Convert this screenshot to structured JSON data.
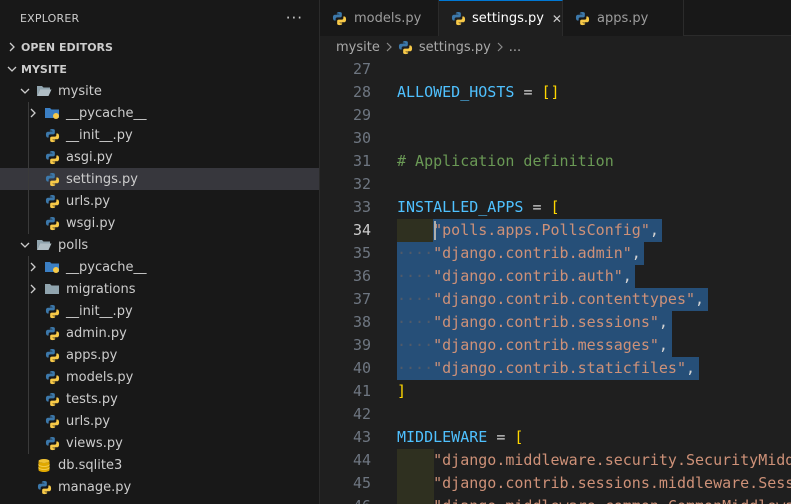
{
  "explorer": {
    "title": "EXPLORER",
    "more": "···",
    "open_editors": "OPEN EDITORS",
    "project": "MYSITE",
    "tree": [
      {
        "label": "mysite",
        "type": "folder-open",
        "depth": 1
      },
      {
        "label": "__pycache__",
        "type": "folder-pycache",
        "depth": 2
      },
      {
        "label": "__init__.py",
        "type": "python",
        "depth": 2
      },
      {
        "label": "asgi.py",
        "type": "python",
        "depth": 2
      },
      {
        "label": "settings.py",
        "type": "python",
        "depth": 2,
        "selected": true
      },
      {
        "label": "urls.py",
        "type": "python",
        "depth": 2
      },
      {
        "label": "wsgi.py",
        "type": "python",
        "depth": 2
      },
      {
        "label": "polls",
        "type": "folder-open",
        "depth": 1
      },
      {
        "label": "__pycache__",
        "type": "folder-pycache",
        "depth": 2
      },
      {
        "label": "migrations",
        "type": "folder",
        "depth": 2
      },
      {
        "label": "__init__.py",
        "type": "python",
        "depth": 2
      },
      {
        "label": "admin.py",
        "type": "python",
        "depth": 2
      },
      {
        "label": "apps.py",
        "type": "python",
        "depth": 2
      },
      {
        "label": "models.py",
        "type": "python",
        "depth": 2
      },
      {
        "label": "tests.py",
        "type": "python",
        "depth": 2
      },
      {
        "label": "urls.py",
        "type": "python",
        "depth": 2
      },
      {
        "label": "views.py",
        "type": "python",
        "depth": 2
      },
      {
        "label": "db.sqlite3",
        "type": "database",
        "depth": 1
      },
      {
        "label": "manage.py",
        "type": "python",
        "depth": 1
      }
    ]
  },
  "tabs": [
    {
      "label": "models.py",
      "active": false
    },
    {
      "label": "settings.py",
      "active": true
    },
    {
      "label": "apps.py",
      "active": false
    }
  ],
  "tab_close": "✕",
  "breadcrumb": {
    "folder": "mysite",
    "file": "settings.py",
    "more": "..."
  },
  "editor": {
    "current_line": 34,
    "lines": [
      {
        "n": "27",
        "text": ""
      },
      {
        "n": "28",
        "text": "ALLOWED_HOSTS = []"
      },
      {
        "n": "29",
        "text": ""
      },
      {
        "n": "30",
        "text": ""
      },
      {
        "n": "31",
        "text": "# Application definition"
      },
      {
        "n": "32",
        "text": ""
      },
      {
        "n": "33",
        "text": "INSTALLED_APPS = ["
      },
      {
        "n": "34",
        "text": "\"polls.apps.PollsConfig\","
      },
      {
        "n": "35",
        "text": "\"django.contrib.admin\","
      },
      {
        "n": "36",
        "text": "\"django.contrib.auth\","
      },
      {
        "n": "37",
        "text": "\"django.contrib.contenttypes\","
      },
      {
        "n": "38",
        "text": "\"django.contrib.sessions\","
      },
      {
        "n": "39",
        "text": "\"django.contrib.messages\","
      },
      {
        "n": "40",
        "text": "\"django.contrib.staticfiles\","
      },
      {
        "n": "41",
        "text": "]"
      },
      {
        "n": "42",
        "text": ""
      },
      {
        "n": "43",
        "text": "MIDDLEWARE = ["
      },
      {
        "n": "44",
        "text": "\"django.middleware.security.SecurityMiddleware\","
      },
      {
        "n": "45",
        "text": "\"django.contrib.sessions.middleware.SessionMiddleware\","
      },
      {
        "n": "46",
        "text": "\"django.middleware.common.CommonMiddleware\","
      }
    ]
  },
  "colors": {
    "accent": "#0078d4",
    "selection": "#264f78",
    "string": "#ce9178",
    "variable": "#4fc1ff",
    "comment": "#6a9955",
    "bracket": "#ffd700"
  }
}
